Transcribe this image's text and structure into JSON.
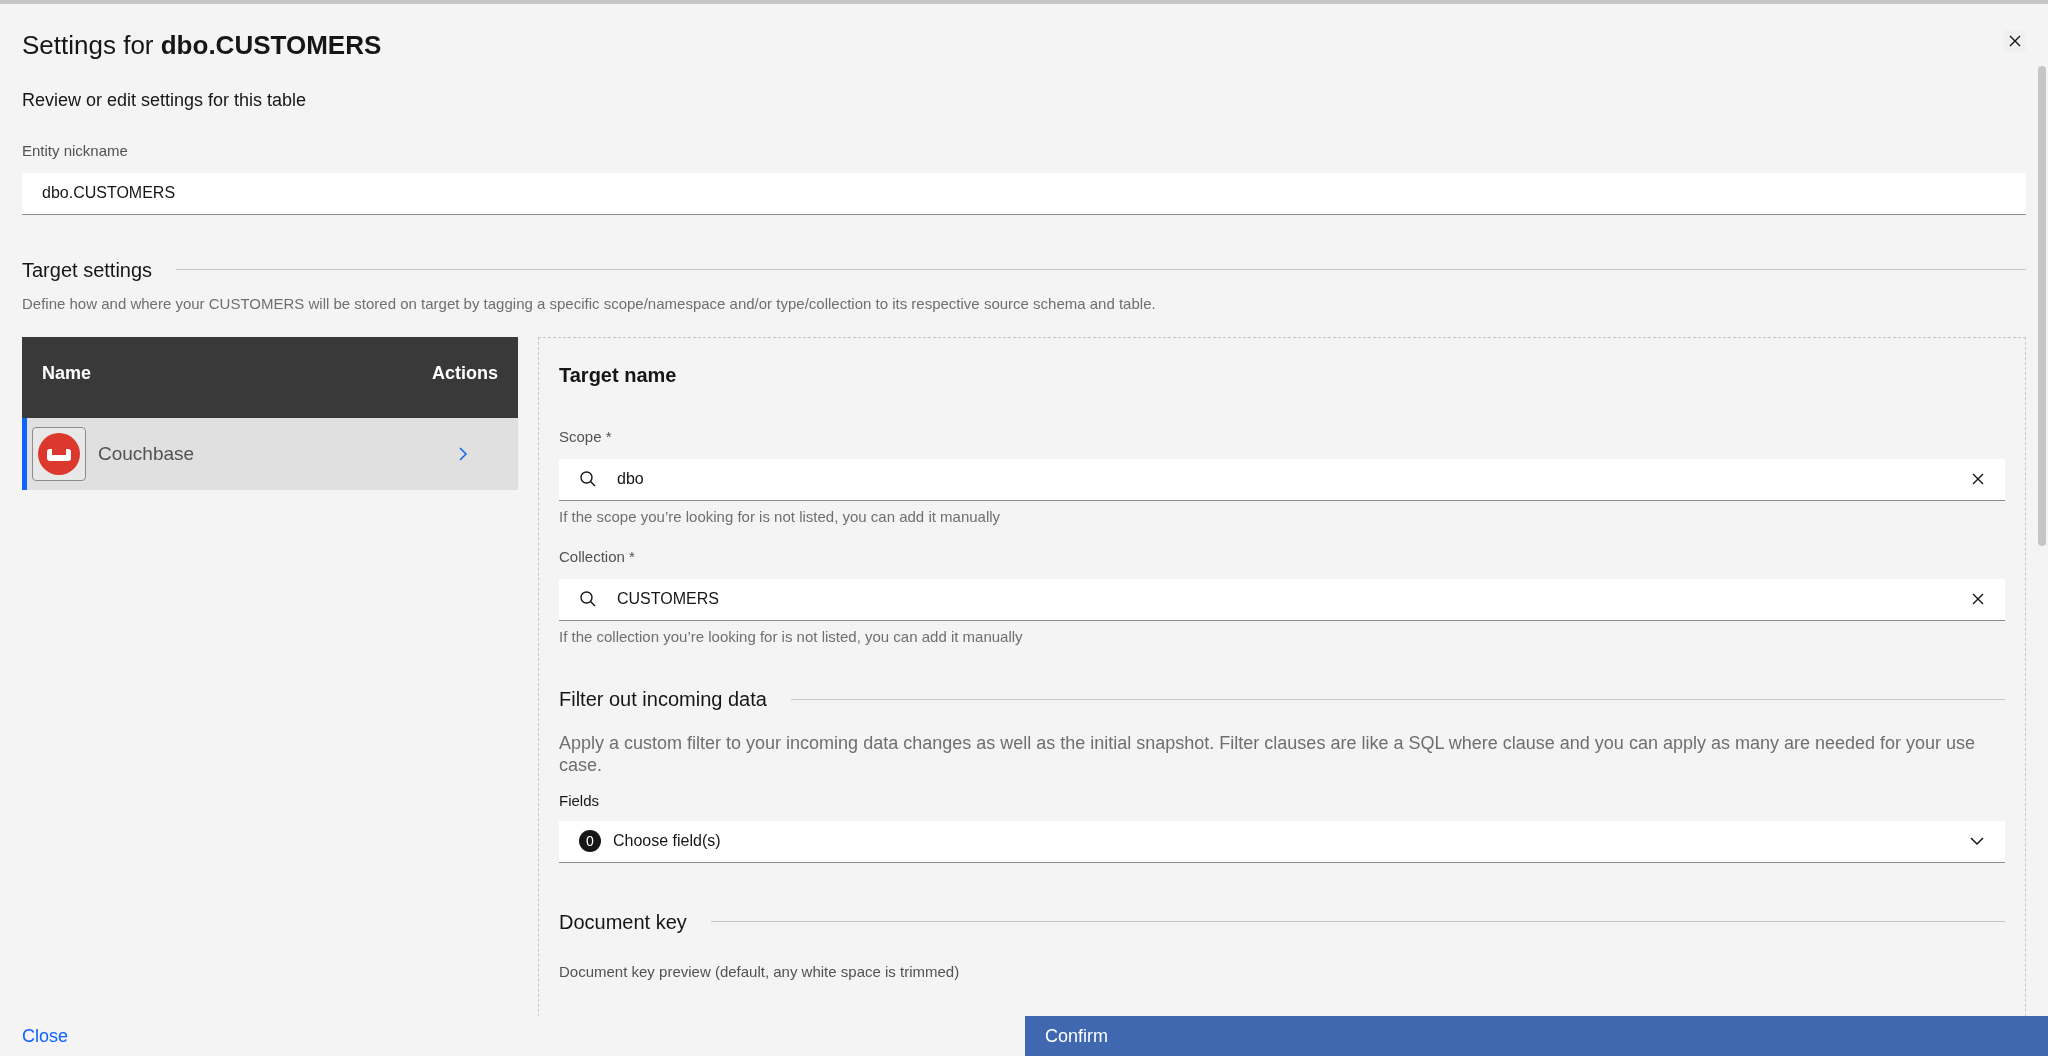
{
  "dialog": {
    "title_prefix": "Settings for ",
    "title_entity": "dbo.CUSTOMERS",
    "subtitle": "Review or edit settings for this table"
  },
  "nickname": {
    "label": "Entity nickname",
    "value": "dbo.CUSTOMERS"
  },
  "target_settings": {
    "heading": "Target settings",
    "description": "Define how and where your CUSTOMERS will be stored on target by tagging a specific scope/namespace and/or type/collection to its respective source schema and table."
  },
  "targets_table": {
    "columns": [
      "Name",
      "Actions"
    ],
    "rows": [
      {
        "name": "Couchbase",
        "selected": true
      }
    ]
  },
  "target_name": {
    "heading": "Target name",
    "fields": [
      {
        "label": "Scope *",
        "value": "dbo",
        "helper": "If the scope you’re looking for is not listed, you can add it manually"
      },
      {
        "label": "Collection *",
        "value": "CUSTOMERS",
        "helper": "If the collection you’re looking for is not listed, you can add it manually"
      }
    ]
  },
  "filter": {
    "heading": "Filter out incoming data",
    "description": "Apply a custom filter to your incoming data changes as well as the initial snapshot. Filter clauses are like a SQL where clause and you can apply as many are needed for your use case.",
    "fields_label": "Fields",
    "count": "0",
    "placeholder": "Choose field(s)"
  },
  "document_key": {
    "heading": "Document key",
    "preview_label": "Document key preview (default, any white space is trimmed)"
  },
  "footer": {
    "close": "Close",
    "confirm": "Confirm"
  }
}
